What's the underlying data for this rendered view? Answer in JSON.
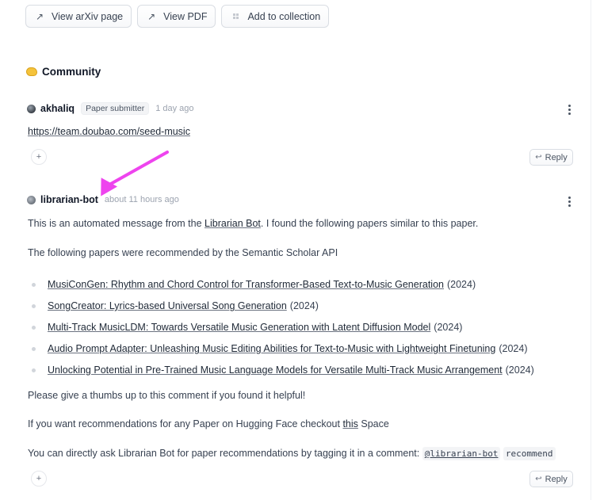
{
  "top_buttons": [
    {
      "label": "View arXiv page",
      "icon": "arrow-up-right-icon"
    },
    {
      "label": "View PDF",
      "icon": "arrow-up-right-icon"
    },
    {
      "label": "Add to collection",
      "icon": "grid-icon"
    }
  ],
  "community": {
    "title": "Community",
    "icon": "community-blob-icon"
  },
  "comments": [
    {
      "username": "akhaliq",
      "badge": "Paper submitter",
      "time": "1 day ago",
      "link": "https://team.doubao.com/seed-music",
      "reply_label": "Reply",
      "react_label": "+"
    },
    {
      "username": "librarian-bot",
      "time": "about 11 hours ago",
      "intro_pre": "This is an automated message from the ",
      "intro_link": "Librarian Bot",
      "intro_post": ". I found the following papers similar to this paper.",
      "api_line": "The following papers were recommended by the Semantic Scholar API",
      "recommendations": [
        {
          "title": "MusiConGen: Rhythm and Chord Control for Transformer-Based Text-to-Music Generation",
          "year": "(2024)"
        },
        {
          "title": "SongCreator: Lyrics-based Universal Song Generation",
          "year": "(2024)"
        },
        {
          "title": "Multi-Track MusicLDM: Towards Versatile Music Generation with Latent Diffusion Model",
          "year": "(2024)"
        },
        {
          "title": "Audio Prompt Adapter: Unleashing Music Editing Abilities for Text-to-Music with Lightweight Finetuning",
          "year": "(2024)"
        },
        {
          "title": "Unlocking Potential in Pre-Trained Music Language Models for Versatile Multi-Track Music Arrangement",
          "year": "(2024)"
        }
      ],
      "thumbs": "Please give a thumbs up to this comment if you found it helpful!",
      "space_pre": "If you want recommendations for any Paper on Hugging Face checkout ",
      "space_link": "this",
      "space_post": " Space",
      "ask_pre": "You can directly ask Librarian Bot for paper recommendations by tagging it in a comment: ",
      "ask_mention": "@librarian-bot",
      "ask_command": "recommend",
      "reply_label": "Reply",
      "react_label": "+"
    }
  ],
  "annotation": {
    "color": "#ee44ee"
  }
}
